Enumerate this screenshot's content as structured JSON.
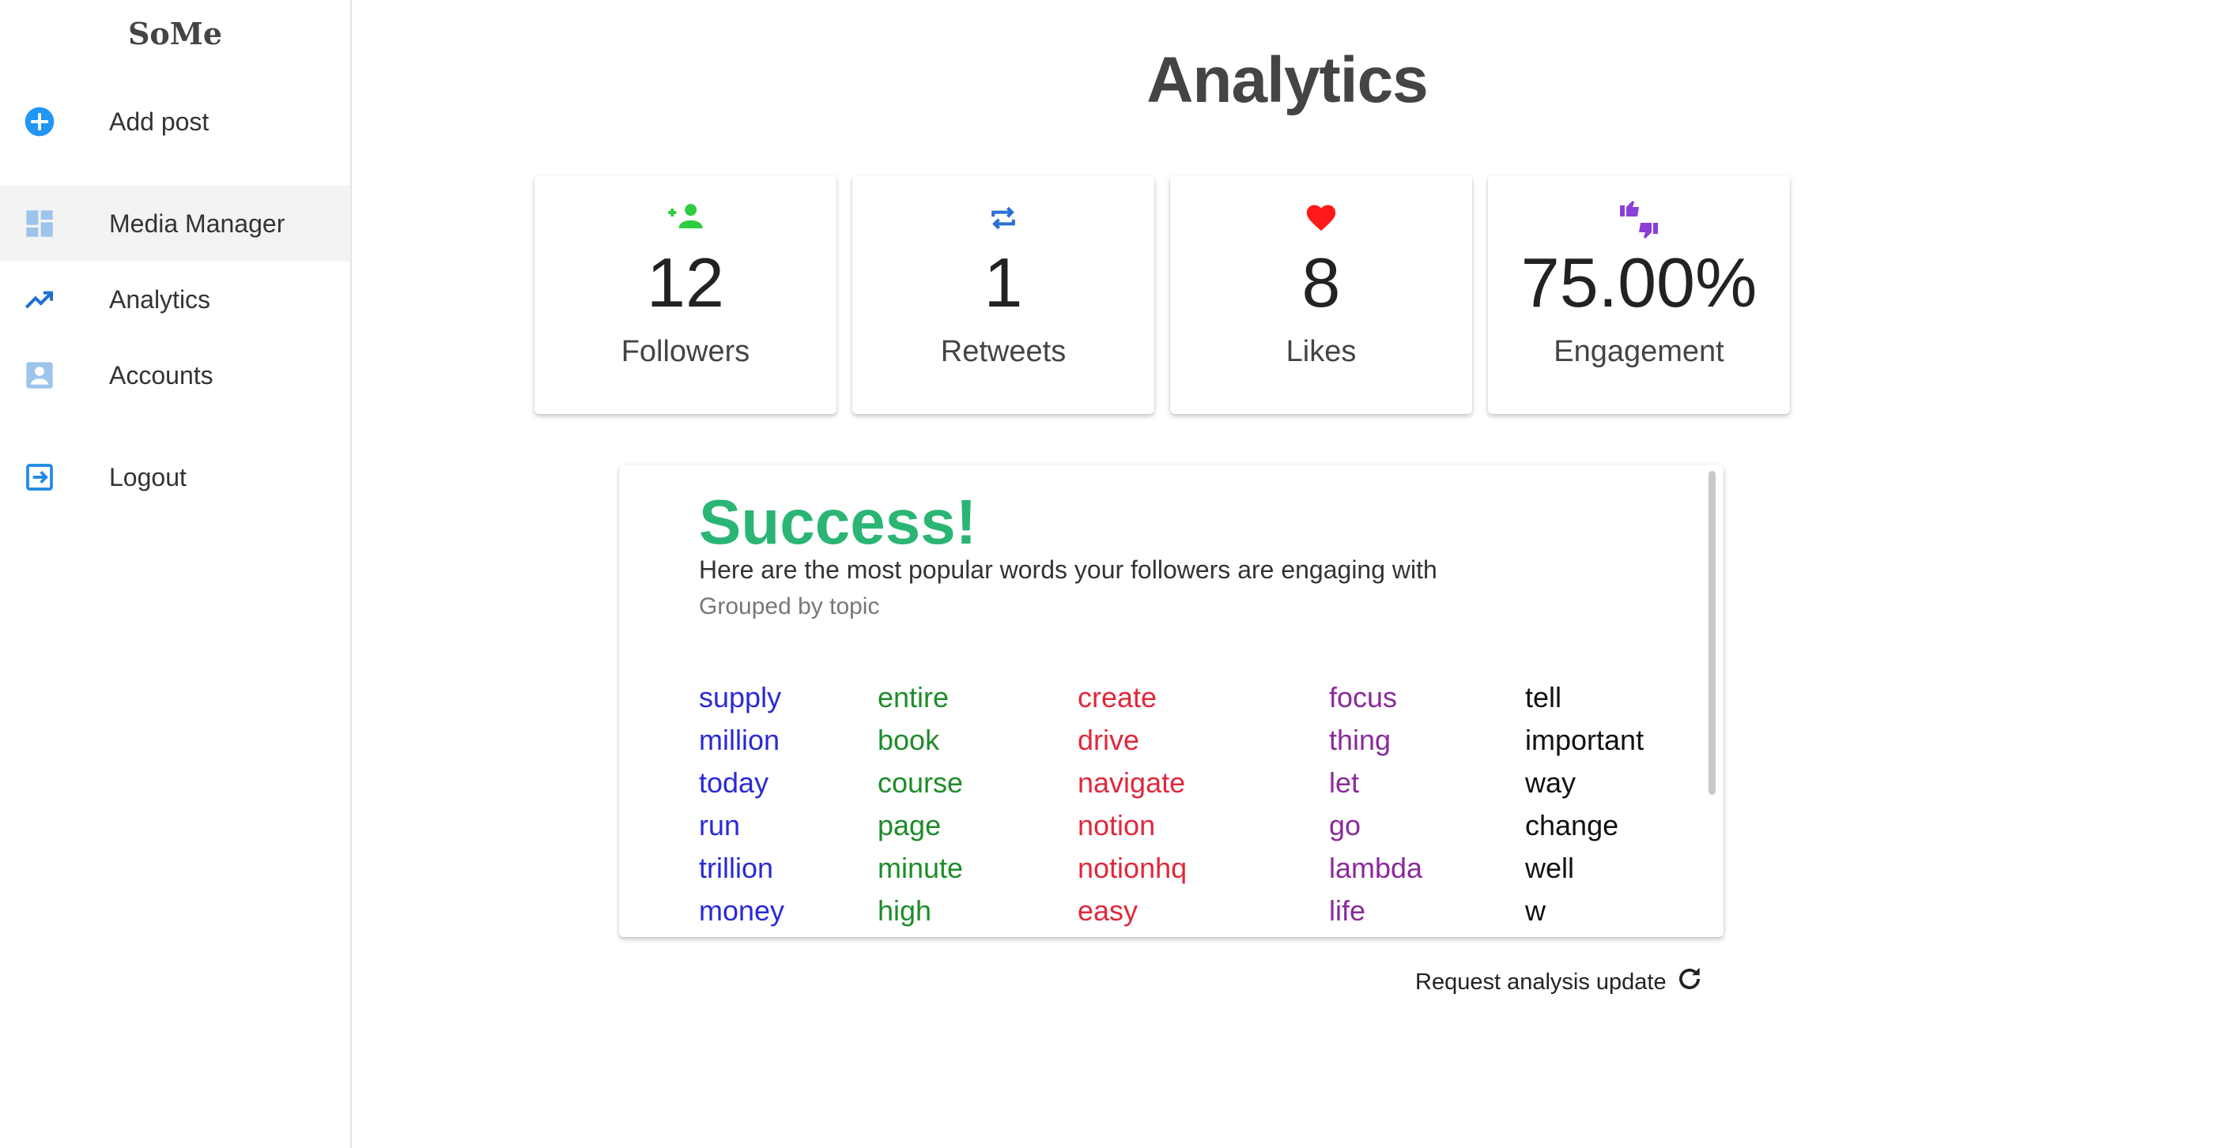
{
  "app": {
    "brand": "SoMe"
  },
  "sidebar": {
    "items": [
      {
        "label": "Add post",
        "icon": "add-circle-icon"
      },
      {
        "label": "Media Manager",
        "icon": "dashboard-icon"
      },
      {
        "label": "Analytics",
        "icon": "trending-up-icon"
      },
      {
        "label": "Accounts",
        "icon": "account-box-icon"
      },
      {
        "label": "Logout",
        "icon": "logout-icon"
      }
    ],
    "active_item": "Media Manager"
  },
  "page": {
    "title": "Analytics"
  },
  "stats": [
    {
      "value": "12",
      "label": "Followers",
      "icon": "person-add-icon",
      "color": "#2ecc40"
    },
    {
      "value": "1",
      "label": "Retweets",
      "icon": "repeat-icon",
      "color": "#2b6fd6"
    },
    {
      "value": "8",
      "label": "Likes",
      "icon": "heart-icon",
      "color": "#ff1a1a"
    },
    {
      "value": "75.00%",
      "label": "Engagement",
      "icon": "thumbs-up-down-icon",
      "color": "#8a3fd6"
    }
  ],
  "words": {
    "title": "Success!",
    "subtitle": "Here are the most popular words your followers are engaging with",
    "grouping": "Grouped by topic",
    "topics": [
      {
        "color": "#2a2ad6",
        "words": [
          "supply",
          "million",
          "today",
          "run",
          "trillion",
          "money"
        ]
      },
      {
        "color": "#1e8c2a",
        "words": [
          "entire",
          "book",
          "course",
          "page",
          "minute",
          "high"
        ]
      },
      {
        "color": "#e0283c",
        "words": [
          "create",
          "drive",
          "navigate",
          "notion",
          "notionhq",
          "easy"
        ]
      },
      {
        "color": "#8a2a9c",
        "words": [
          "focus",
          "thing",
          "let",
          "go",
          "lambda",
          "life"
        ]
      },
      {
        "color": "#111111",
        "words": [
          "tell",
          "important",
          "way",
          "change",
          "well",
          "w"
        ]
      }
    ]
  },
  "actions": {
    "request_update_label": "Request analysis update",
    "request_update_icon": "refresh-icon"
  }
}
